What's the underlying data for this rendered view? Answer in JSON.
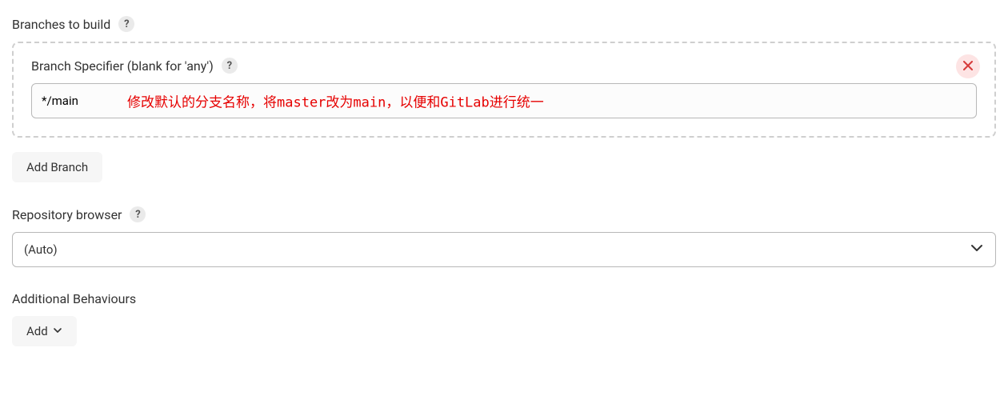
{
  "branches": {
    "title": "Branches to build",
    "specifier_label": "Branch Specifier (blank for 'any')",
    "specifier_value": "*/main",
    "annotation": "修改默认的分支名称，将master改为main，以便和GitLab进行统一",
    "add_branch_label": "Add Branch"
  },
  "repo_browser": {
    "title": "Repository browser",
    "selected": "(Auto)"
  },
  "additional": {
    "title": "Additional Behaviours",
    "add_label": "Add"
  },
  "icons": {
    "help": "?"
  }
}
